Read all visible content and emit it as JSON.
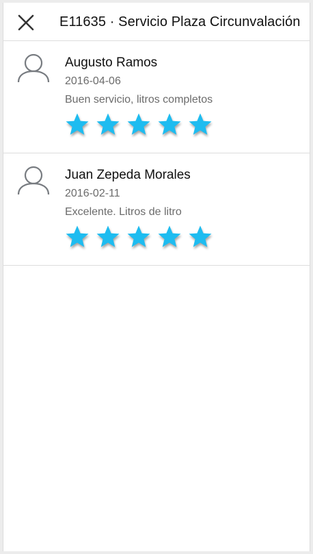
{
  "header": {
    "title": "E11635 · Servicio Plaza Circunvalación",
    "close_icon": "close-icon"
  },
  "colors": {
    "star": "#1ebcf0",
    "text_primary": "#111111",
    "text_secondary": "#6b6b6b"
  },
  "reviews": [
    {
      "name": "Augusto Ramos",
      "date": "2016-04-06",
      "comment": "Buen servicio, litros completos",
      "rating": 5,
      "max_rating": 5,
      "avatar_icon": "user-icon"
    },
    {
      "name": "Juan Zepeda Morales",
      "date": "2016-02-11",
      "comment": "Excelente. Litros de litro",
      "rating": 5,
      "max_rating": 5,
      "avatar_icon": "user-icon"
    }
  ]
}
